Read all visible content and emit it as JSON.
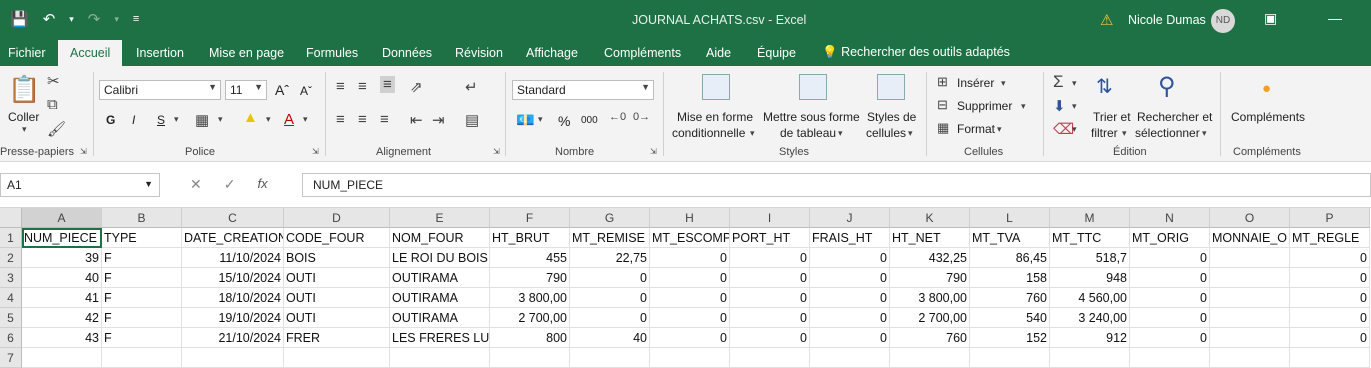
{
  "window": {
    "title": "JOURNAL ACHATS.csv  -  Excel",
    "user_name": "Nicole Dumas",
    "user_initials": "ND"
  },
  "colors": {
    "accent": "#1e7145",
    "ribbon_bg": "#f3f3f3"
  },
  "tabs": [
    {
      "label": "Fichier"
    },
    {
      "label": "Accueil"
    },
    {
      "label": "Insertion"
    },
    {
      "label": "Mise en page"
    },
    {
      "label": "Formules"
    },
    {
      "label": "Données"
    },
    {
      "label": "Révision"
    },
    {
      "label": "Affichage"
    },
    {
      "label": "Compléments"
    },
    {
      "label": "Aide"
    },
    {
      "label": "Équipe"
    }
  ],
  "search_label": "Rechercher des outils adaptés",
  "ribbon": {
    "clipboard": {
      "paste_label": "Coller",
      "group_label": "Presse-papiers"
    },
    "font": {
      "font_name": "Calibri",
      "font_size": "11",
      "group_label": "Police",
      "bold": "G",
      "italic": "I",
      "underline": "S"
    },
    "alignment": {
      "group_label": "Alignement"
    },
    "number": {
      "format": "Standard",
      "group_label": "Nombre",
      "percent": "%",
      "thousands": "000"
    },
    "styles": {
      "cond_format_line1": "Mise en forme",
      "cond_format_line2": "conditionnelle",
      "table_line1": "Mettre sous forme",
      "table_line2": "de tableau",
      "cell_styles_line1": "Styles de",
      "cell_styles_line2": "cellules",
      "group_label": "Styles"
    },
    "cells": {
      "insert": "Insérer",
      "delete": "Supprimer",
      "format": "Format",
      "group_label": "Cellules"
    },
    "editing": {
      "sort_line1": "Trier et",
      "sort_line2": "filtrer",
      "find_line1": "Rechercher et",
      "find_line2": "sélectionner",
      "group_label": "Édition"
    },
    "addins": {
      "label": "Compléments",
      "group_label": "Compléments"
    }
  },
  "formula_bar": {
    "name_box": "A1",
    "formula": "NUM_PIECE",
    "fx": "fx"
  },
  "sheet": {
    "columns": [
      "A",
      "B",
      "C",
      "D",
      "E",
      "F",
      "G",
      "H",
      "I",
      "J",
      "K",
      "L",
      "M",
      "N",
      "O",
      "P"
    ],
    "row_numbers": [
      "1",
      "2",
      "3",
      "4",
      "5",
      "6",
      "7"
    ],
    "rows": [
      [
        "NUM_PIECE",
        "TYPE",
        "DATE_CREATION",
        "CODE_FOUR",
        "NOM_FOUR",
        "HT_BRUT",
        "MT_REMISE",
        "MT_ESCOMP",
        "PORT_HT",
        "FRAIS_HT",
        "HT_NET",
        "MT_TVA",
        "MT_TTC",
        "MT_ORIG",
        "MONNAIE_O",
        "MT_REGLE"
      ],
      [
        "39",
        "F",
        "11/10/2024",
        "BOIS",
        "LE ROI DU BOIS",
        "455",
        "22,75",
        "0",
        "0",
        "0",
        "432,25",
        "86,45",
        "518,7",
        "0",
        "",
        "0"
      ],
      [
        "40",
        "F",
        "15/10/2024",
        "OUTI",
        "OUTIRAMA",
        "790",
        "0",
        "0",
        "0",
        "0",
        "790",
        "158",
        "948",
        "0",
        "",
        "0"
      ],
      [
        "41",
        "F",
        "18/10/2024",
        "OUTI",
        "OUTIRAMA",
        "3 800,00",
        "0",
        "0",
        "0",
        "0",
        "3 800,00",
        "760",
        "4 560,00",
        "0",
        "",
        "0"
      ],
      [
        "42",
        "F",
        "19/10/2024",
        "OUTI",
        "OUTIRAMA",
        "2 700,00",
        "0",
        "0",
        "0",
        "0",
        "2 700,00",
        "540",
        "3 240,00",
        "0",
        "",
        "0"
      ],
      [
        "43",
        "F",
        "21/10/2024",
        "FRER",
        "LES FRERES LUM",
        "800",
        "40",
        "0",
        "0",
        "0",
        "760",
        "152",
        "912",
        "0",
        "",
        "0"
      ],
      [
        "",
        "",
        "",
        "",
        "",
        "",
        "",
        "",
        "",
        "",
        "",
        "",
        "",
        "",
        "",
        ""
      ]
    ]
  }
}
